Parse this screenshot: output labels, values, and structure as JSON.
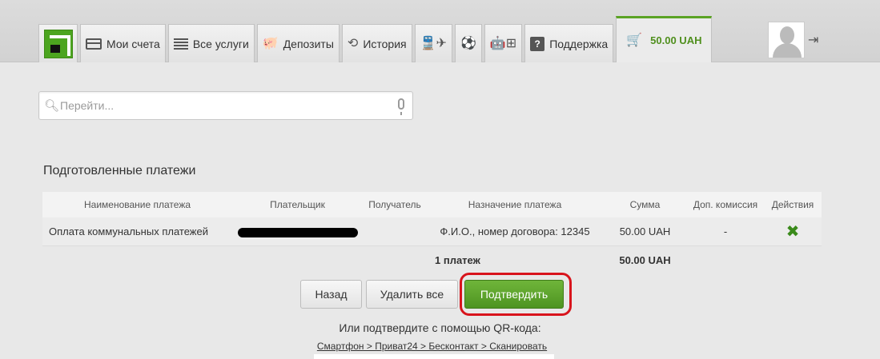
{
  "nav": {
    "tabs": [
      {
        "label": "Мои счета",
        "icon": "card-icon"
      },
      {
        "label": "Все услуги",
        "icon": "list-icon"
      },
      {
        "label": "Депозиты",
        "icon": "piggy-bank-icon"
      },
      {
        "label": "История",
        "icon": "history-icon"
      },
      {
        "label": "",
        "icon": "transport-icon"
      },
      {
        "label": "",
        "icon": "mobile-platforms-icon"
      },
      {
        "label": "Поддержка",
        "icon": "question-icon"
      }
    ],
    "cart_amount": "50.00 UAH"
  },
  "search": {
    "placeholder": "Перейти...",
    "value": ""
  },
  "section_title": "Подготовленные платежи",
  "table": {
    "headers": [
      "Наименование платежа",
      "Плательщик",
      "Получатель",
      "Назначение платежа",
      "Сумма",
      "Доп. комиссия",
      "Действия"
    ],
    "rows": [
      {
        "name": "Оплата коммунальных платежей",
        "payer": "",
        "recipient": "",
        "purpose": "Ф.И.О., номер договора: 12345",
        "amount": "50.00 UAH",
        "commission": "-"
      }
    ],
    "total_count": "1  платеж",
    "total_amount": "50.00 UAH"
  },
  "buttons": {
    "back": "Назад",
    "delete_all": "Удалить все",
    "confirm": "Подтвердить"
  },
  "qr": {
    "text": "Или подтвердите с помощью QR-кода:",
    "link": "Смартфон > Приват24 > Бесконтакт > Сканировать"
  },
  "colors": {
    "accent_green": "#5ba324",
    "highlight_red": "#d8141c"
  }
}
